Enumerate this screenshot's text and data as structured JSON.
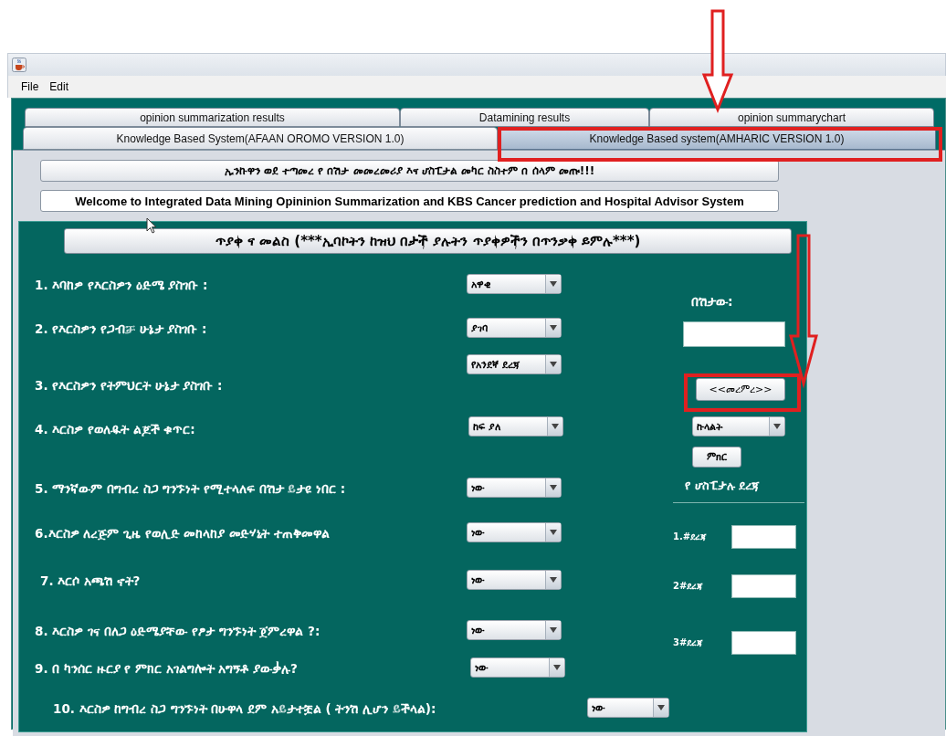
{
  "menu": [
    "File",
    "Edit"
  ],
  "tab_rows": [
    [
      {
        "label": "opinion summarization results",
        "selected": false
      },
      {
        "label": "Datamining results",
        "selected": false
      },
      {
        "label": "opinion summarychart",
        "selected": false
      }
    ],
    [
      {
        "label": "Knowledge Based System(AFAAN OROMO VERSION 1.0)",
        "selected": false
      },
      {
        "label": "Knowledge Based system(AMHARIC VERSION 1.0)",
        "selected": true
      }
    ]
  ],
  "banners": [
    "ኢንኩዋን ወደ ተጣመረ የ በሽታ መመረመሪያ እና ሆስፒታል መካር ስስተም በ ሰላም መጡ!!!",
    "Welcome to Integrated Data Mining Opininion Summarization and KBS Cancer prediction and Hospital Advisor System"
  ],
  "questionnaire": {
    "title": "ጥያቀ ና መልስ (***ኢባኮትን ከዝህ በታች ያሉትን ጥያቀዎችን በጥንቃቀ ይምሉ***)",
    "questions": [
      {
        "label": "1. እባከዎ የእርስዎን ዕድሜ ያስገቡ :",
        "answer": "አዋቂ"
      },
      {
        "label": "2. የእርስዎን የጋብቻ ሁኔታ ያስገቡ :",
        "answer": "ያገባ"
      },
      {
        "label": "3. የእርስዎን የትምህርት ሁኔታ ያስገቡ :",
        "answer": "የአንደኛ ደረጃ"
      },
      {
        "label": "4. እርስዎ የወለዱት ልጆች ቁጥር:",
        "answer": "ከፍ ያለ"
      },
      {
        "label": "5. ማንኛውም በግብረ ስጋ ግንኙነት የሚተላለፍ በሽታ ይታዩ ነበር :",
        "answer": "ነው"
      },
      {
        "label": "6.እርስዎ ለረጅም ጊዜ የወሊድ መከላከያ መድሃኒት ተጠቅመዋል",
        "answer": "ነው"
      },
      {
        "label": "7. እርሶ አጫሽ ኖት?",
        "answer": "ነው"
      },
      {
        "label": "8. እርስዎ ገና በለጋ ዕድሜያቸው የፆታ ግንኙነት ጀምረዋል ?:",
        "answer": "ነው"
      },
      {
        "label": "9. በ ካንሰር ዙርያ የ ምክር አገልግሎት አግኝቶ ያውቃሉ?",
        "answer": "ነው"
      },
      {
        "label": "10.  እርስዎ ከግብረ ስጋ ግንኙነት በሁዋላ ደም አይታተቿል ( ትንሽ ሊሆን ይችላል):",
        "answer": "ነው"
      }
    ]
  },
  "diagnosis": {
    "label": "በሽታው:",
    "diagnose_button": "<<መረምረ>>",
    "advice_choice": "ኩላልት",
    "advice_button": "ምክር"
  },
  "hospital_rank": {
    "title": "የ ሆስፒታሉ ደረጃ",
    "ranks": [
      "1.#ደረጃ",
      "2#ደረጃ",
      "3#ደረጃ"
    ]
  }
}
